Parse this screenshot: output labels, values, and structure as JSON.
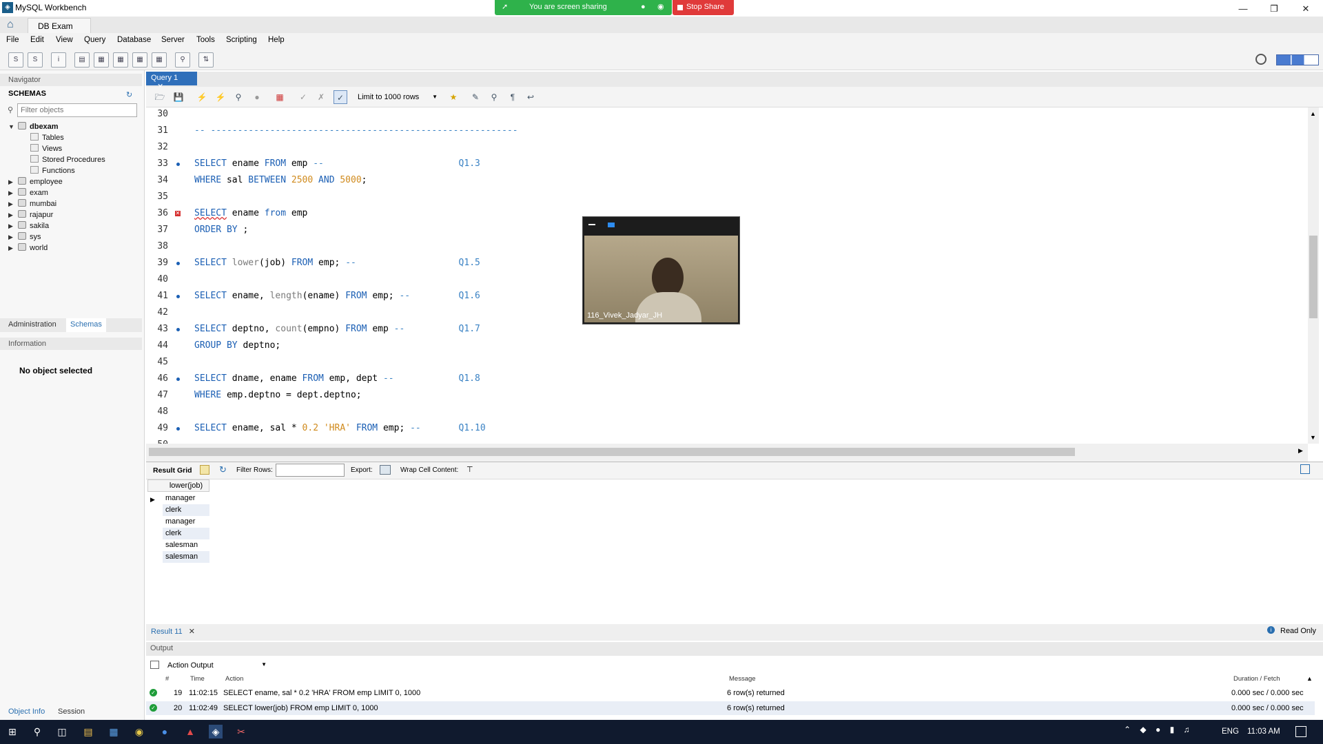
{
  "window": {
    "title": "MySQL Workbench",
    "minimize_icon": "minimize-icon",
    "restore_icon": "restore-icon",
    "close_icon": "close-icon"
  },
  "screen_share": {
    "status_text": "You are screen sharing",
    "stop_label": "Stop Share"
  },
  "connection_tab": {
    "label": "DB Exam"
  },
  "menu": [
    "File",
    "Edit",
    "View",
    "Query",
    "Database",
    "Server",
    "Tools",
    "Scripting",
    "Help"
  ],
  "navigator": {
    "title": "Navigator",
    "schemas_label": "SCHEMAS",
    "filter_placeholder": "Filter objects",
    "active_schema": "dbexam",
    "active_children": [
      "Tables",
      "Views",
      "Stored Procedures",
      "Functions"
    ],
    "other_schemas": [
      "employee",
      "exam",
      "mumbai",
      "rajapur",
      "sakila",
      "sys",
      "world"
    ],
    "tabs": [
      "Administration",
      "Schemas"
    ],
    "information_title": "Information",
    "no_object": "No object selected",
    "bottom_tabs": [
      "Object Info",
      "Session"
    ]
  },
  "query_tab": {
    "label": "Query 1"
  },
  "editor_toolbar": {
    "limit_label": "Limit to 1000 rows"
  },
  "editor_lines": [
    {
      "n": "30",
      "text": ""
    },
    {
      "n": "31",
      "text": "-- ---------------------------------------------------------"
    },
    {
      "n": "32",
      "text": ""
    },
    {
      "n": "33",
      "text": "SELECT ename FROM emp --                         Q1.3"
    },
    {
      "n": "34",
      "text": "WHERE sal BETWEEN 2500 AND 5000;"
    },
    {
      "n": "35",
      "text": ""
    },
    {
      "n": "36",
      "text": "SELECT ename from emp"
    },
    {
      "n": "37",
      "text": "ORDER BY ;"
    },
    {
      "n": "38",
      "text": ""
    },
    {
      "n": "39",
      "text": "SELECT lower(job) FROM emp; --                   Q1.5"
    },
    {
      "n": "40",
      "text": ""
    },
    {
      "n": "41",
      "text": "SELECT ename, length(ename) FROM emp; --         Q1.6"
    },
    {
      "n": "42",
      "text": ""
    },
    {
      "n": "43",
      "text": "SELECT deptno, count(empno) FROM emp --          Q1.7"
    },
    {
      "n": "44",
      "text": "GROUP BY deptno;"
    },
    {
      "n": "45",
      "text": ""
    },
    {
      "n": "46",
      "text": "SELECT dname, ename FROM emp, dept --            Q1.8"
    },
    {
      "n": "47",
      "text": "WHERE emp.deptno = dept.deptno;"
    },
    {
      "n": "48",
      "text": ""
    },
    {
      "n": "49",
      "text": "SELECT ename, sal * 0.2 'HRA' FROM emp; --       Q1.10"
    },
    {
      "n": "50",
      "text": ""
    }
  ],
  "webcam": {
    "participant": "116_Vivek_Jadyar_JH"
  },
  "result_toolbar": {
    "result_grid": "Result Grid",
    "filter_rows": "Filter Rows:",
    "export": "Export:",
    "wrap": "Wrap Cell Content:"
  },
  "result": {
    "column": "lower(job)",
    "rows": [
      "manager",
      "clerk",
      "manager",
      "clerk",
      "salesman",
      "salesman"
    ]
  },
  "result_tab": {
    "label": "Result 11",
    "read_only": "Read Only"
  },
  "output": {
    "title": "Output",
    "selector": "Action Output",
    "headers": [
      "#",
      "Time",
      "Action",
      "Message",
      "Duration / Fetch"
    ],
    "rows": [
      {
        "num": "19",
        "time": "11:02:15",
        "action": "SELECT ename, sal * 0.2 'HRA' FROM emp LIMIT 0, 1000",
        "message": "6 row(s) returned",
        "duration": "0.000 sec / 0.000 sec"
      },
      {
        "num": "20",
        "time": "11:02:49",
        "action": "SELECT lower(job) FROM emp LIMIT 0, 1000",
        "message": "6 row(s) returned",
        "duration": "0.000 sec / 0.000 sec"
      }
    ]
  },
  "taskbar": {
    "lang": "ENG",
    "clock": "11:03 AM"
  }
}
